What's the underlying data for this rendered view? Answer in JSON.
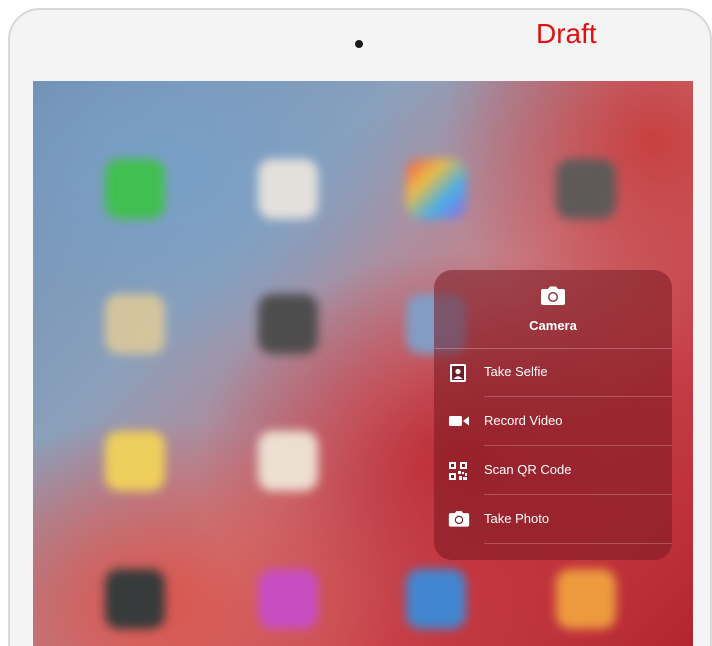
{
  "watermark": {
    "text": "Draft"
  },
  "quick_actions": {
    "app_title": "Camera",
    "app_icon": "camera-icon",
    "items": [
      {
        "label": "Take Selfie",
        "icon": "selfie-icon"
      },
      {
        "label": "Record Video",
        "icon": "video-icon"
      },
      {
        "label": "Scan QR Code",
        "icon": "qr-code-icon"
      },
      {
        "label": "Take Photo",
        "icon": "camera-icon"
      }
    ]
  },
  "home_screen": {
    "app_icon_colors": [
      "#3fc14a",
      "#e9e4de",
      "#f2a040",
      "#5a5a5a",
      "#d9c79c",
      "#4a4a4a",
      "#7fa0c8",
      "#f2d35a",
      "#f0e6d6",
      "#2f3a3a",
      "#c84cc8",
      "#3c8ad8",
      "#f0a040"
    ]
  },
  "colors": {
    "panel_background": "rgba(120,25,35,0.55)",
    "watermark": "#e01010"
  }
}
